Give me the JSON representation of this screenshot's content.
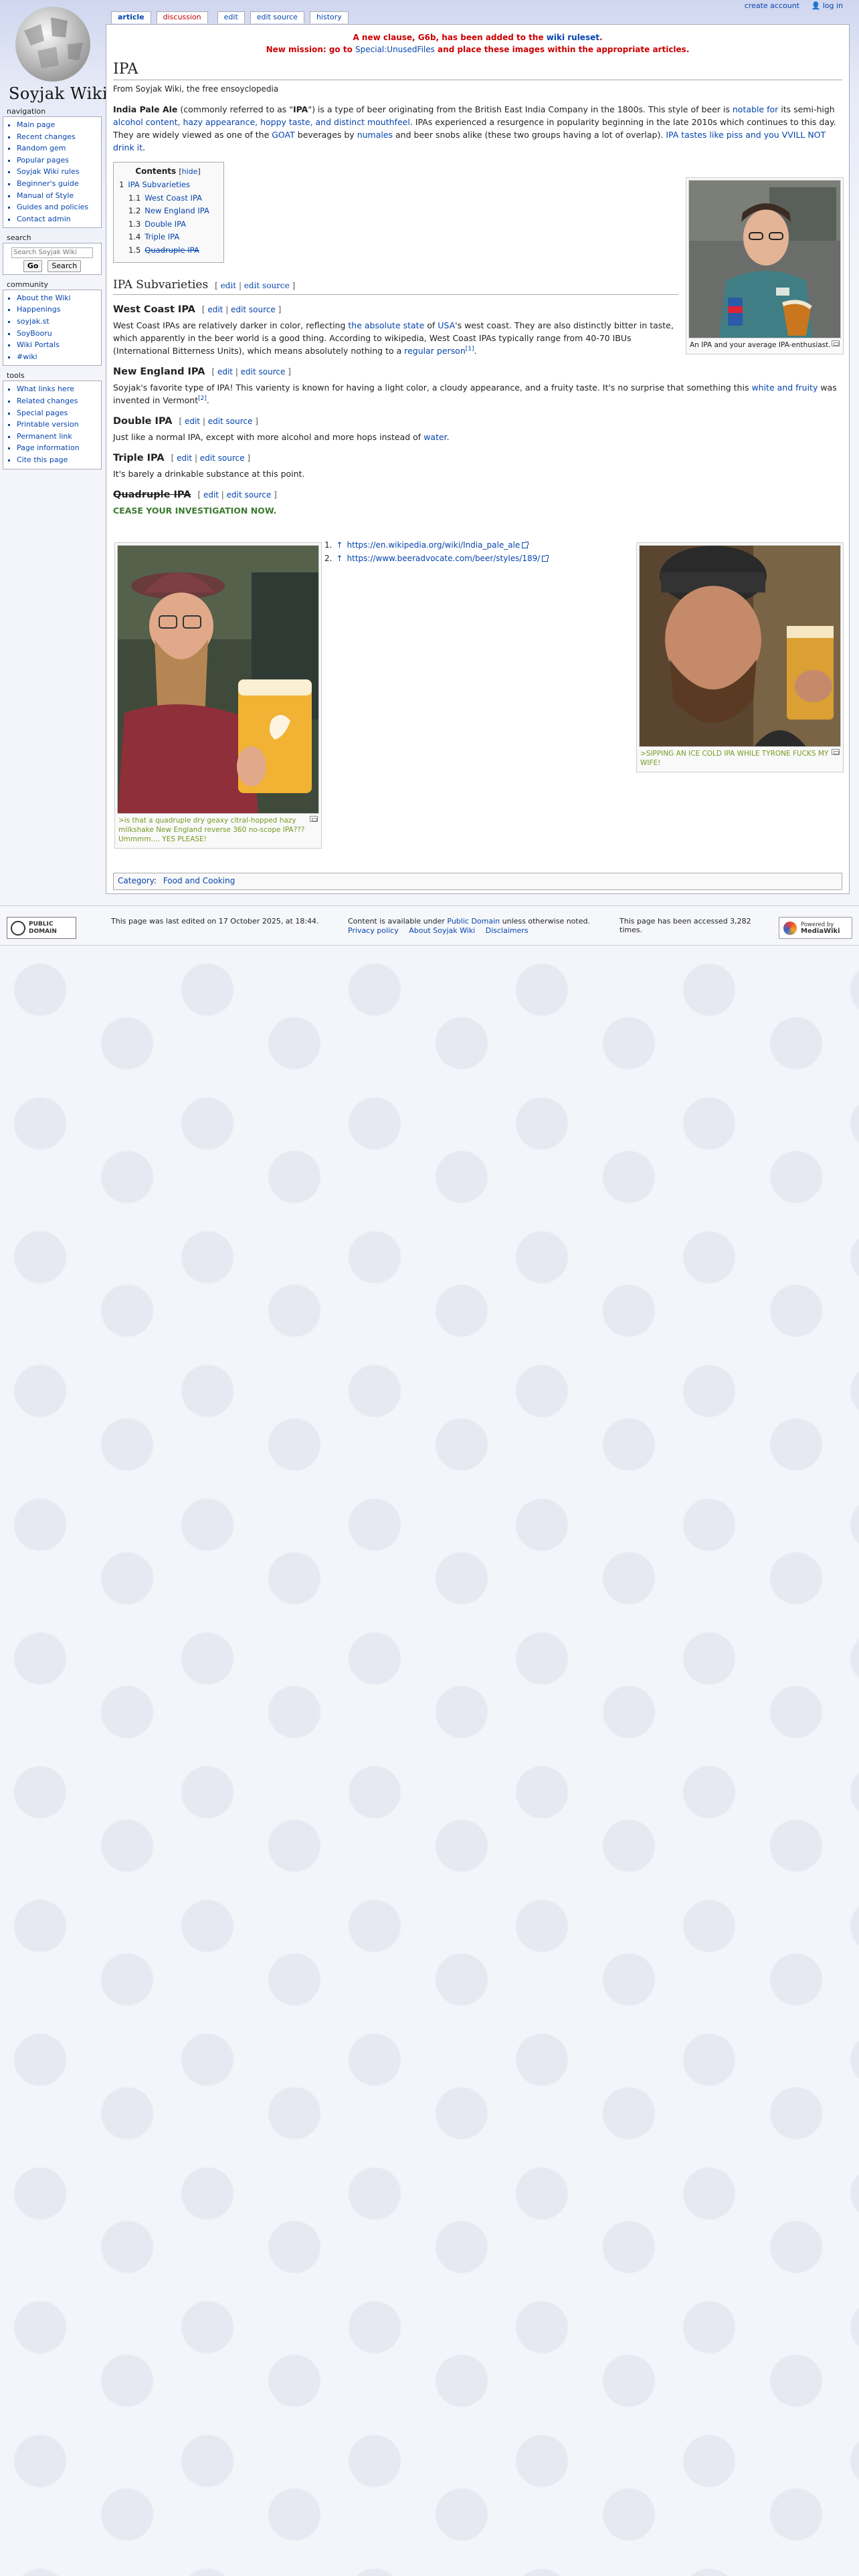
{
  "site": {
    "logo_text": "Soyjak Wiki",
    "personal": [
      "create account",
      "log in"
    ]
  },
  "tabs": [
    {
      "label": "article"
    },
    {
      "label": "discussion"
    },
    {
      "label": "edit"
    },
    {
      "label": "edit source"
    },
    {
      "label": "history"
    }
  ],
  "sidebar": {
    "navigation": {
      "title": "navigation",
      "items": [
        "Main page",
        "Recent changes",
        "Random gem",
        "Popular pages",
        "Soyjak Wiki rules",
        "Beginner's guide",
        "Manual of Style",
        "Guides and policies",
        "Contact admin"
      ]
    },
    "search": {
      "title": "search",
      "placeholder": "Search Soyjak Wiki",
      "go": "Go",
      "search": "Search"
    },
    "community": {
      "title": "community",
      "items": [
        "About the Wiki",
        "Happenings",
        "soyjak.st",
        "SoyBooru",
        "Wiki Portals",
        "#wiki"
      ]
    },
    "tools": {
      "title": "tools",
      "items": [
        "What links here",
        "Related changes",
        "Special pages",
        "Printable version",
        "Permanent link",
        "Page information",
        "Cite this page"
      ]
    }
  },
  "sitenotice": {
    "line1_a": "A new clause, G6b, has been added to the ",
    "line1_link": "wiki ruleset",
    "line1_b": ".",
    "line2_a": "New mission: go to ",
    "line2_link": "Special:UnusedFiles",
    "line2_b": " and place these images within the appropriate articles."
  },
  "article": {
    "title": "IPA",
    "sitesub": "From Soyjak Wiki, the free ensoyclopedia",
    "intro": {
      "bold1": "India Pale Ale",
      "t1": " (commonly referred to as \"",
      "bold2": "IPA",
      "t2": "\") is a type of beer originating from the British East India Company in the 1800s. This style of beer is ",
      "l1": "notable for",
      "t3": " its semi-high ",
      "l2": "alcohol content, hazy appearance, hoppy taste, and distinct mouthfeel",
      "t4": ". IPAs experienced a resurgence in popularity beginning in the late 2010s which continues to this day. They are widely viewed as one of the ",
      "l3": "GOAT",
      "t5": " beverages by ",
      "l4": "numales",
      "t6": " and beer snobs alike (these two groups having a lot of overlap). ",
      "l5": "IPA tastes like piss and you VVILL NOT drink it",
      "t7": "."
    },
    "toc": {
      "title": "Contents",
      "hide": "hide",
      "items": [
        {
          "num": "1",
          "label": "IPA Subvarieties"
        },
        {
          "num": "1.1",
          "label": "West Coast IPA"
        },
        {
          "num": "1.2",
          "label": "New England IPA"
        },
        {
          "num": "1.3",
          "label": "Double IPA"
        },
        {
          "num": "1.4",
          "label": "Triple IPA"
        },
        {
          "num": "1.5",
          "label": "Quadruple IPA"
        }
      ]
    },
    "thumb1_caption": "An IPA and your average IPA-enthusiast.",
    "h2_subvarieties": "IPA Subvarieties",
    "edit_label": "edit",
    "edit_source_label": "edit source",
    "west_coast": {
      "heading": "West Coast IPA",
      "t1": "West Coast IPAs are relatively darker in color, reflecting ",
      "l1": "the absolute state",
      "t2": " of ",
      "l2": "USA",
      "t3": "'s west coast. They are also distinctly bitter in taste, which apparently in the beer world is a good thing. According to wikipedia, West Coast IPAs typically range from 40-70 IBUs (International Bitterness Units), which means absolutely nothing to a ",
      "l3": "regular person",
      "ref": "[1]",
      "t4": "."
    },
    "new_england": {
      "heading": "New England IPA",
      "t1": "Soyjak's favorite type of IPA! This varienty is known for having a light color, a cloudy appearance, and a fruity taste. It's no surprise that something this ",
      "l1": "white and fruity",
      "t2": " was invented in Vermont",
      "ref": "[2]",
      "t3": "."
    },
    "double": {
      "heading": "Double IPA",
      "t1": "Just like a normal IPA, except with more alcohol and more hops instead of ",
      "l1": "water",
      "t2": "."
    },
    "triple": {
      "heading": "Triple IPA",
      "t1": "It's barely a drinkable substance at this point."
    },
    "quadruple": {
      "heading": "Quadruple IPA",
      "t1": "CEASE YOUR INVESTIGATION NOW."
    },
    "thumb2_caption": ">is that a quadruple dry geaxy citral-hopped hazy milkshake New England reverse 360 no-scope IPA??? Ummmm.... YES PLEASE!",
    "thumb3_caption": ">SIPPING AN ICE COLD IPA WHILE TYRONE FUCKS MY WIFE!",
    "references": [
      {
        "num": "1.",
        "arrow": "↑",
        "url": "https://en.wikipedia.org/wiki/India_pale_ale"
      },
      {
        "num": "2.",
        "arrow": "↑",
        "url": "https://www.beeradvocate.com/beer/styles/189/"
      }
    ],
    "category_label": "Category",
    "category": "Food and Cooking"
  },
  "footer": {
    "pd_badge": "PUBLIC DOMAIN",
    "last_edited": "This page was last edited on 17 October 2025, at 18:44.",
    "content_a": "Content is available under ",
    "content_link": "Public Domain",
    "content_b": " unless otherwise noted.",
    "links": [
      "Privacy policy",
      "About Soyjak Wiki",
      "Disclaimers"
    ],
    "accessed": "This page has been accessed 3,282 times.",
    "mw_badge_1": "Powered by",
    "mw_badge_2": "MediaWiki"
  },
  "colors": {
    "link": "#0645ad",
    "new_link": "#ba0000",
    "notice": "#cc0000",
    "greentext": "#789922",
    "quad_text": "#3b7a2e"
  }
}
